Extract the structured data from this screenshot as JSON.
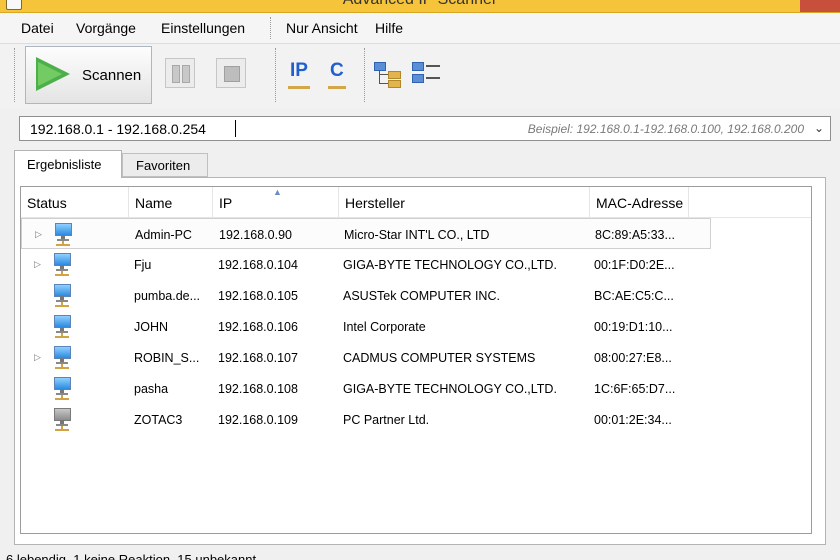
{
  "window": {
    "title": "Advanced IP Scanner"
  },
  "menu": [
    "Datei",
    "Vorgänge",
    "Einstellungen",
    "Nur Ansicht",
    "Hilfe"
  ],
  "toolbar": {
    "scan_label": "Scannen",
    "ip_label": "IP",
    "c_label": "C"
  },
  "address": {
    "value": "192.168.0.1 - 192.168.0.254",
    "placeholder": "Beispiel: 192.168.0.1-192.168.0.100, 192.168.0.200"
  },
  "tabs": [
    {
      "label": "Ergebnisliste",
      "active": true
    },
    {
      "label": "Favoriten",
      "active": false
    }
  ],
  "table": {
    "columns": [
      "Status",
      "Name",
      "IP",
      "Hersteller",
      "MAC-Adresse"
    ],
    "rows": [
      {
        "expandable": true,
        "online": true,
        "name": "Admin-PC",
        "ip": "192.168.0.90",
        "vendor": "Micro-Star INT'L CO., LTD",
        "mac": "8C:89:A5:33..."
      },
      {
        "expandable": true,
        "online": true,
        "name": "Fju",
        "ip": "192.168.0.104",
        "vendor": "GIGA-BYTE TECHNOLOGY CO.,LTD.",
        "mac": "00:1F:D0:2E..."
      },
      {
        "expandable": false,
        "online": true,
        "name": "pumba.de...",
        "ip": "192.168.0.105",
        "vendor": "ASUSTek COMPUTER INC.",
        "mac": "BC:AE:C5:C..."
      },
      {
        "expandable": false,
        "online": true,
        "name": "JOHN",
        "ip": "192.168.0.106",
        "vendor": "Intel Corporate",
        "mac": "00:19:D1:10..."
      },
      {
        "expandable": true,
        "online": true,
        "name": "ROBIN_S...",
        "ip": "192.168.0.107",
        "vendor": "CADMUS COMPUTER SYSTEMS",
        "mac": "08:00:27:E8..."
      },
      {
        "expandable": false,
        "online": true,
        "name": "pasha",
        "ip": "192.168.0.108",
        "vendor": "GIGA-BYTE TECHNOLOGY CO.,LTD.",
        "mac": "1C:6F:65:D7..."
      },
      {
        "expandable": false,
        "online": false,
        "name": "ZOTAC3",
        "ip": "192.168.0.109",
        "vendor": "PC Partner Ltd.",
        "mac": "00:01:2E:34..."
      }
    ]
  },
  "status": {
    "text": "6 lebendig, 1 keine Reaktion, 15 unbekannt"
  },
  "colors": {
    "accent": "#f5c43b",
    "scan_green": "#4cb04a",
    "icon_blue": "#1f5fd0"
  }
}
